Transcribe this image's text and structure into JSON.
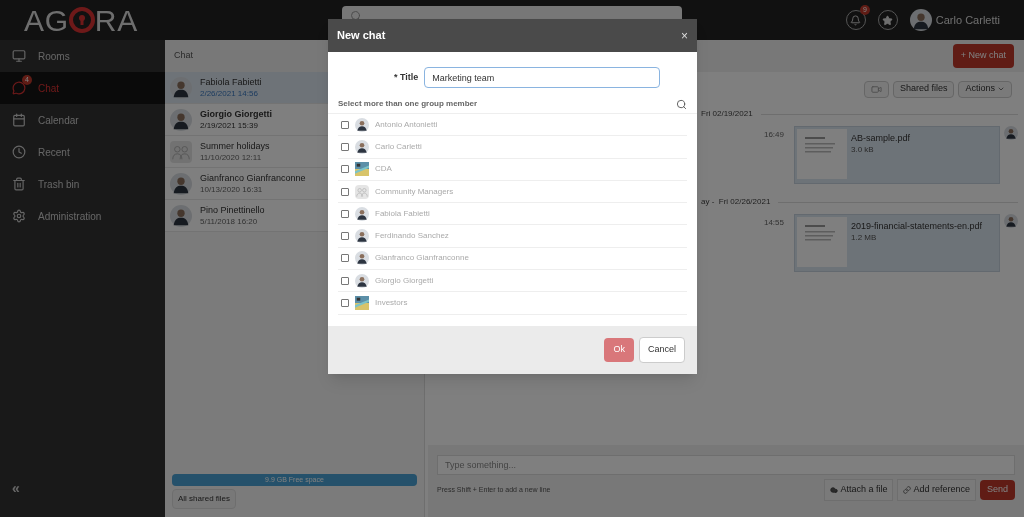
{
  "header": {
    "logo": "AG",
    "logo_tail": "RA",
    "notifications": "9",
    "user": "Carlo Carletti"
  },
  "sidebar": {
    "items": [
      {
        "label": "Rooms",
        "kind": "rooms",
        "selected": false
      },
      {
        "label": "Chat",
        "kind": "chat",
        "selected": true,
        "badge": "4"
      },
      {
        "label": "Calendar",
        "kind": "calendar",
        "selected": false
      },
      {
        "label": "Recent",
        "kind": "recent",
        "selected": false
      },
      {
        "label": "Trash bin",
        "kind": "trash",
        "selected": false
      },
      {
        "label": "Administration",
        "kind": "admin",
        "selected": false
      }
    ],
    "collapse": "«"
  },
  "chat_list": {
    "title": "Chat",
    "items": [
      {
        "name": "Fabiola Fabietti",
        "time": "2/26/2021 14:56",
        "selected": true,
        "unread": false,
        "kind": "person"
      },
      {
        "name": "Giorgio Giorgetti",
        "time": "2/19/2021 15:39",
        "selected": false,
        "unread": true,
        "kind": "person"
      },
      {
        "name": "Summer holidays",
        "time": "11/10/2020 12:11",
        "selected": false,
        "unread": false,
        "kind": "group"
      },
      {
        "name": "Gianfranco Gianfranconne",
        "time": "10/13/2020 16:31",
        "selected": false,
        "unread": false,
        "kind": "person"
      },
      {
        "name": "Pino Pinettinello",
        "time": "5/11/2018 16:20",
        "selected": false,
        "unread": false,
        "kind": "person"
      }
    ],
    "storage": {
      "label": "9.9 GB Free space",
      "level": 1
    },
    "all_files": "All shared files"
  },
  "conversation": {
    "new_chat": "+ New chat",
    "shared_files": "Shared files",
    "actions": "Actions",
    "days": [
      {
        "label": "Fri 02/19/2021",
        "messages": [
          {
            "time": "16:49",
            "file": "AB-sample.pdf",
            "size": "3.0 kB"
          }
        ]
      },
      {
        "label": "ay -  Fri 02/26/2021",
        "messages": [
          {
            "time": "14:55",
            "file": "2019-financial-statements-en.pdf",
            "size": "1.2 MB"
          }
        ]
      }
    ],
    "composer": {
      "placeholder": "Type something...",
      "hint": "Press Shift + Enter to add a new line",
      "attach": "Attach a file",
      "reference": "Add reference",
      "send": "Send"
    }
  },
  "dialog": {
    "title": "New chat",
    "close": "×",
    "title_label": "* Title",
    "title_value": "Marketing team",
    "members_label": "Select more than one group member",
    "members": [
      {
        "name": "Antonio Antonietti",
        "checked": false,
        "kind": "person"
      },
      {
        "name": "Carlo Carletti",
        "checked": false,
        "kind": "person"
      },
      {
        "name": "CDA",
        "checked": false
      },
      {
        "name": "Community Managers",
        "checked": false,
        "kind": "group"
      },
      {
        "name": "Fabiola Fabietti",
        "checked": false,
        "kind": "person"
      },
      {
        "name": "Ferdinando Sanchez",
        "checked": false,
        "kind": "person"
      },
      {
        "name": "Gianfranco Gianfranconne",
        "checked": false,
        "kind": "person"
      },
      {
        "name": "Giorgio Giorgetti",
        "checked": false,
        "kind": "person"
      },
      {
        "name": "Investors",
        "checked": false
      }
    ],
    "ok": "Ok",
    "cancel": "Cancel"
  }
}
